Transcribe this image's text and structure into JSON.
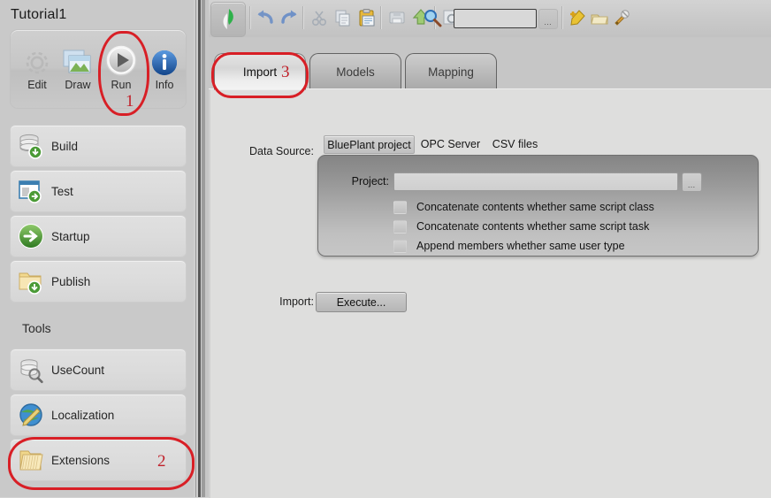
{
  "app": {
    "project_title": "Tutorial1"
  },
  "sidebar": {
    "modes": [
      {
        "label": "Edit",
        "icon": "gear-icon"
      },
      {
        "label": "Draw",
        "icon": "images-icon"
      },
      {
        "label": "Run",
        "icon": "play-icon"
      },
      {
        "label": "Info",
        "icon": "info-icon"
      }
    ],
    "nav_items": [
      {
        "label": "Build",
        "icon": "database-download-icon"
      },
      {
        "label": "Test",
        "icon": "window-run-icon"
      },
      {
        "label": "Startup",
        "icon": "green-arrow-icon"
      },
      {
        "label": "Publish",
        "icon": "folder-download-icon"
      }
    ],
    "tools_header": "Tools",
    "tool_items": [
      {
        "label": "UseCount",
        "icon": "database-search-icon"
      },
      {
        "label": "Localization",
        "icon": "globe-pencil-icon"
      },
      {
        "label": "Extensions",
        "icon": "folder-icon"
      }
    ]
  },
  "toolbar": {
    "app_icon": "bluplant-logo-icon",
    "items": [
      {
        "name": "undo-icon",
        "glyph": "↶",
        "color": "#6e8ec4",
        "enabled": true
      },
      {
        "name": "redo-icon",
        "glyph": "↷",
        "color": "#6e8ec4",
        "enabled": true
      },
      {
        "name": "cut-icon",
        "glyph": "✂",
        "color": "#a8a8a8",
        "enabled": false
      },
      {
        "name": "copy-icon",
        "glyph": "⧉",
        "color": "#a9adb4",
        "enabled": false
      },
      {
        "name": "paste-icon",
        "glyph": "ὌB",
        "color": "#d9a21f",
        "enabled": true
      },
      {
        "name": "save-icon",
        "glyph": "ὋE",
        "color": "#b0b0b0",
        "enabled": false
      },
      {
        "name": "upload-icon",
        "glyph": "⬆",
        "color": "#8fbf62",
        "enabled": true
      },
      {
        "name": "find-icon",
        "glyph": "ὐE",
        "color": "#a9a9a9",
        "enabled": false
      },
      {
        "name": "search-icon",
        "glyph": "ὐD",
        "color": "#3f7fd0",
        "enabled": true
      }
    ],
    "search_value": "",
    "more_button_label": "…",
    "right_items": [
      {
        "name": "add-tag-icon",
        "glyph": "❖",
        "color": "#e8b820"
      },
      {
        "name": "folder-tag-icon",
        "glyph": "▰",
        "color": "#e0cf8f"
      },
      {
        "name": "tools-icon",
        "glyph": "⚒",
        "color": "#c9943c"
      }
    ]
  },
  "tabs": [
    {
      "label": "Import",
      "active": true
    },
    {
      "label": "Models",
      "active": false
    },
    {
      "label": "Mapping",
      "active": false
    }
  ],
  "form": {
    "data_source_label": "Data Source:",
    "data_source_options": [
      {
        "label": "BluePlant project",
        "selected": true
      },
      {
        "label": "OPC Server",
        "selected": false
      },
      {
        "label": "CSV files",
        "selected": false
      }
    ],
    "project_label": "Project:",
    "project_value": "",
    "browse_label": "…",
    "checkboxes": [
      {
        "label": "Concatenate contents whether same script class",
        "checked": false
      },
      {
        "label": "Concatenate contents whether same script task",
        "checked": false
      },
      {
        "label": "Append members whether same user type",
        "checked": false
      }
    ],
    "import_label": "Import:",
    "execute_button": "Execute..."
  },
  "annotations": [
    {
      "number": "1",
      "target": "run-mode-button"
    },
    {
      "number": "2",
      "target": "sidebar-item-extensions"
    },
    {
      "number": "3",
      "target": "tab-import"
    }
  ],
  "colors": {
    "annotation_red": "#d81f26",
    "accent_blue": "#3f7fd0",
    "accent_green": "#4a9a36",
    "panel_bg": "#dededd"
  }
}
